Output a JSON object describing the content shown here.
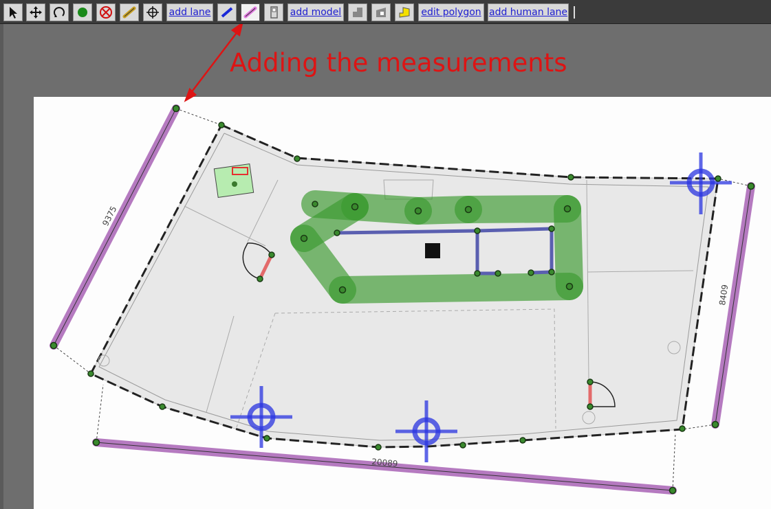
{
  "toolbar": {
    "buttons": [
      {
        "kind": "icon",
        "name": "select-tool-button",
        "icon": "cursor-arrow-icon"
      },
      {
        "kind": "icon",
        "name": "move-tool-button",
        "icon": "move-arrows-icon"
      },
      {
        "kind": "icon",
        "name": "rotate-tool-button",
        "icon": "rotate-arrow-icon"
      },
      {
        "kind": "icon",
        "name": "add-vertex-button",
        "icon": "green-dot-icon"
      },
      {
        "kind": "icon",
        "name": "delete-button",
        "icon": "red-x-circle-icon"
      },
      {
        "kind": "icon",
        "name": "add-measurement-button",
        "icon": "ruler-bar-icon"
      },
      {
        "kind": "icon",
        "name": "add-fiducial-button",
        "icon": "crosshair-icon"
      },
      {
        "kind": "text",
        "name": "add-lane-button",
        "label": "add lane"
      },
      {
        "kind": "icon",
        "name": "add-wall-button",
        "icon": "blue-wall-icon"
      },
      {
        "kind": "icon",
        "name": "add-measurement-lane-button",
        "icon": "pink-measure-icon",
        "active": true
      },
      {
        "kind": "icon",
        "name": "add-door-button",
        "icon": "door-icon"
      },
      {
        "kind": "text",
        "name": "add-model-button",
        "label": "add model"
      },
      {
        "kind": "icon",
        "name": "add-floor-button",
        "icon": "floor-shape-icon"
      },
      {
        "kind": "icon",
        "name": "add-hole-button",
        "icon": "floor-hole-icon"
      },
      {
        "kind": "icon",
        "name": "add-polygon-button",
        "icon": "yellow-polygon-icon"
      },
      {
        "kind": "text",
        "name": "edit-polygon-button",
        "label": "edit polygon"
      },
      {
        "kind": "text",
        "name": "add-human-lane-button",
        "label": "add human lane"
      }
    ]
  },
  "annotation": {
    "text": "Adding the measurements"
  },
  "measurements": {
    "left": "9375",
    "right": "8409",
    "bottom": "20089"
  },
  "colors": {
    "measurement": "#b57ac0",
    "lane": "#3a9a2e",
    "wall": "#5a5fb0",
    "fiducial": "#2a34e0",
    "door": "#e36a6a",
    "annotation": "#dd1414",
    "floor": "#e8e8e8"
  }
}
